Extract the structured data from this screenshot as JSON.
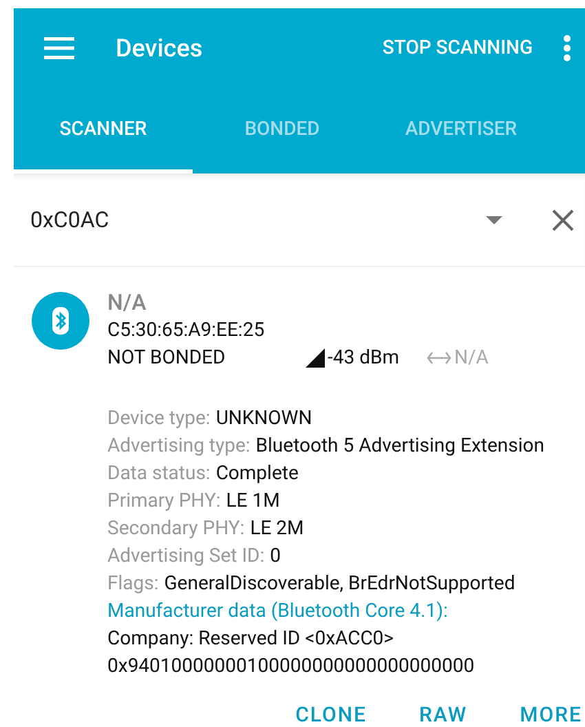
{
  "app_bar": {
    "title": "Devices",
    "action": "STOP SCANNING"
  },
  "tabs": [
    {
      "label": "SCANNER",
      "selected": true
    },
    {
      "label": "BONDED",
      "selected": false
    },
    {
      "label": "ADVERTISER",
      "selected": false
    }
  ],
  "filter": {
    "value": "0xC0AC"
  },
  "device": {
    "name": "N/A",
    "address": "C5:30:65:A9:EE:25",
    "bond_state": "NOT BONDED",
    "rssi": "-43 dBm",
    "interval": "N/A",
    "details": [
      {
        "label": "Device type:",
        "value": "UNKNOWN"
      },
      {
        "label": "Advertising type:",
        "value": "Bluetooth 5 Advertising Extension"
      },
      {
        "label": "Data status:",
        "value": "Complete"
      },
      {
        "label": "Primary PHY:",
        "value": "LE 1M"
      },
      {
        "label": "Secondary PHY:",
        "value": "LE 2M"
      },
      {
        "label": "Advertising Set ID:",
        "value": "0"
      },
      {
        "label": "Flags:",
        "value": "GeneralDiscoverable, BrEdrNotSupported"
      }
    ],
    "manufacturer": {
      "title": "Manufacturer data (Bluetooth Core 4.1):",
      "company": "Company: Reserved ID <0xACC0>",
      "data": "0x94010000000100000000000000000000"
    },
    "buttons": [
      "CLONE",
      "RAW",
      "MORE"
    ]
  }
}
